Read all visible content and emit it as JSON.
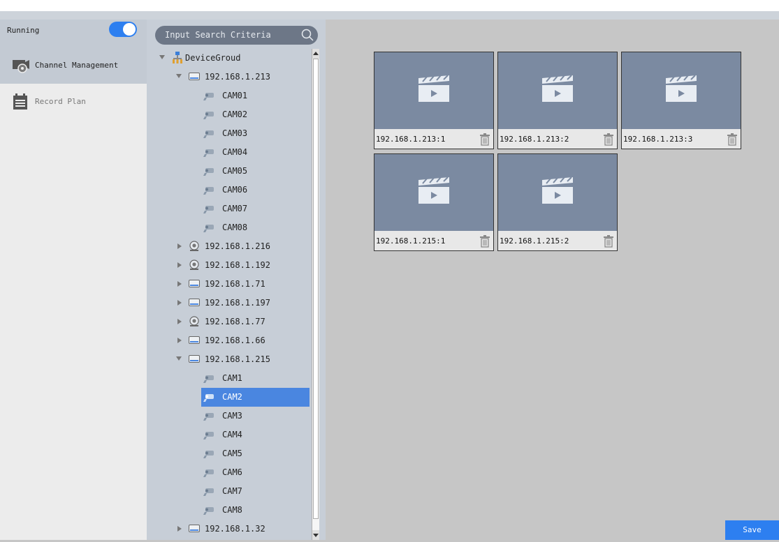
{
  "sidebar": {
    "running_label": "Running",
    "running_on": true,
    "items": [
      {
        "label": "Channel Management",
        "icon": "channel-management-icon",
        "active": true
      },
      {
        "label": "Record Plan",
        "icon": "record-plan-icon",
        "active": false
      }
    ]
  },
  "search": {
    "placeholder": "Input Search Criteria"
  },
  "tree": {
    "root": "DeviceGroud",
    "nodes": [
      {
        "label": "192.168.1.213",
        "type": "nvr",
        "level": 1,
        "expanded": true
      },
      {
        "label": "CAM01",
        "type": "cam",
        "level": 2
      },
      {
        "label": "CAM02",
        "type": "cam",
        "level": 2
      },
      {
        "label": "CAM03",
        "type": "cam",
        "level": 2
      },
      {
        "label": "CAM04",
        "type": "cam",
        "level": 2
      },
      {
        "label": "CAM05",
        "type": "cam",
        "level": 2
      },
      {
        "label": "CAM06",
        "type": "cam",
        "level": 2
      },
      {
        "label": "CAM07",
        "type": "cam",
        "level": 2
      },
      {
        "label": "CAM08",
        "type": "cam",
        "level": 2
      },
      {
        "label": "192.168.1.216",
        "type": "ipc",
        "level": 1,
        "expanded": false
      },
      {
        "label": "192.168.1.192",
        "type": "ipc",
        "level": 1,
        "expanded": false
      },
      {
        "label": "192.168.1.71",
        "type": "nvr",
        "level": 1,
        "expanded": false
      },
      {
        "label": "192.168.1.197",
        "type": "nvr",
        "level": 1,
        "expanded": false
      },
      {
        "label": "192.168.1.77",
        "type": "ipc",
        "level": 1,
        "expanded": false
      },
      {
        "label": "192.168.1.66",
        "type": "nvr",
        "level": 1,
        "expanded": false
      },
      {
        "label": "192.168.1.215",
        "type": "nvr",
        "level": 1,
        "expanded": true
      },
      {
        "label": "CAM1",
        "type": "cam",
        "level": 2
      },
      {
        "label": "CAM2",
        "type": "cam",
        "level": 2,
        "selected": true
      },
      {
        "label": "CAM3",
        "type": "cam",
        "level": 2
      },
      {
        "label": "CAM4",
        "type": "cam",
        "level": 2
      },
      {
        "label": "CAM5",
        "type": "cam",
        "level": 2
      },
      {
        "label": "CAM6",
        "type": "cam",
        "level": 2
      },
      {
        "label": "CAM7",
        "type": "cam",
        "level": 2
      },
      {
        "label": "CAM8",
        "type": "cam",
        "level": 2
      },
      {
        "label": "192.168.1.32",
        "type": "nvr",
        "level": 1,
        "expanded": false
      }
    ]
  },
  "channels": [
    {
      "label": "192.168.1.213:1"
    },
    {
      "label": "192.168.1.213:2"
    },
    {
      "label": "192.168.1.213:3"
    },
    {
      "label": "192.168.1.215:1"
    },
    {
      "label": "192.168.1.215:2"
    }
  ],
  "save_label": "Save",
  "colors": {
    "accent": "#2d7ff0",
    "selected": "#4a86e0",
    "thumb": "#7b8aa1"
  }
}
